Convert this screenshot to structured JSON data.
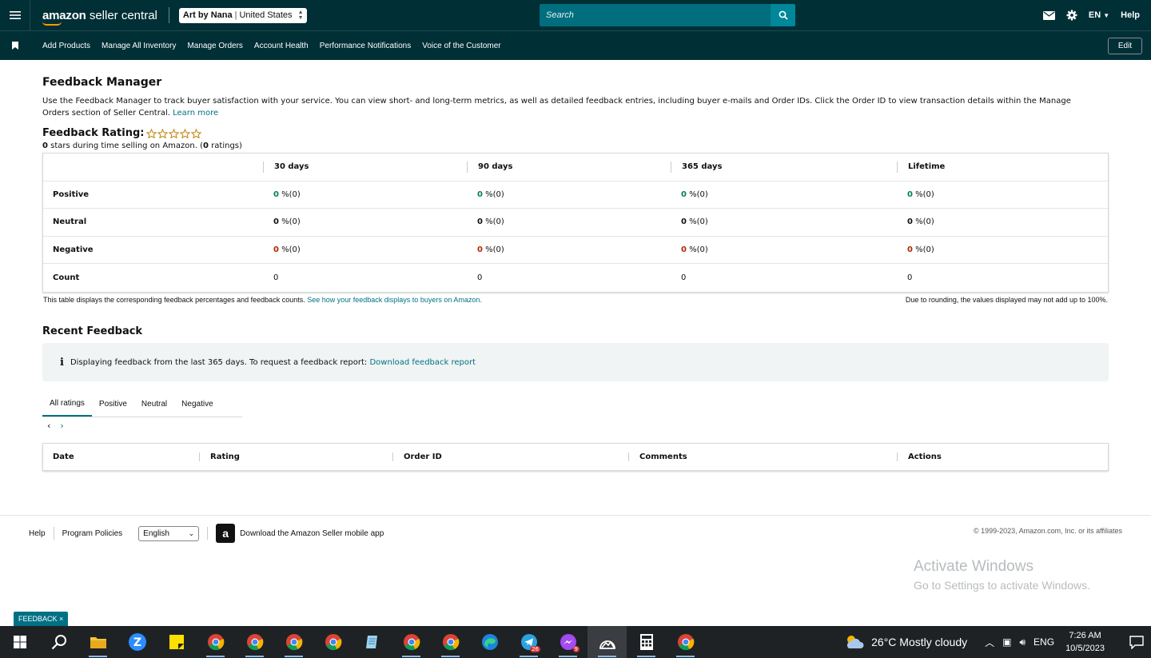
{
  "topbar": {
    "logo_main": "amazon",
    "logo_sub": "seller central",
    "store_name": "Art by Nana",
    "store_country": "United States",
    "search_placeholder": "Search",
    "lang": "EN",
    "help": "Help"
  },
  "nav": {
    "items": [
      "Add Products",
      "Manage All Inventory",
      "Manage Orders",
      "Account Health",
      "Performance Notifications",
      "Voice of the Customer"
    ],
    "edit": "Edit"
  },
  "page": {
    "title": "Feedback Manager",
    "description": "Use the Feedback Manager to track buyer satisfaction with your service. You can view short- and long-term metrics, as well as detailed feedback entries, including buyer e-mails and Order IDs. Click the Order ID to view transaction details within the Manage Orders section of Seller Central.",
    "learn_more": "Learn more",
    "rating_label": "Feedback Rating:",
    "stars_count": "0",
    "rating_sub_text": "stars during time selling on Amazon.",
    "ratings_count": "0",
    "ratings_word": "ratings"
  },
  "metrics": {
    "headers": [
      "30 days",
      "90 days",
      "365 days",
      "Lifetime"
    ],
    "rows": [
      {
        "label": "Positive",
        "cells": [
          {
            "v": "0",
            "p": "%(0)"
          },
          {
            "v": "0",
            "p": "%(0)"
          },
          {
            "v": "0",
            "p": "%(0)"
          },
          {
            "v": "0",
            "p": "%(0)"
          }
        ]
      },
      {
        "label": "Neutral",
        "cells": [
          {
            "v": "0",
            "p": "%(0)"
          },
          {
            "v": "0",
            "p": "%(0)"
          },
          {
            "v": "0",
            "p": "%(0)"
          },
          {
            "v": "0",
            "p": "%(0)"
          }
        ]
      },
      {
        "label": "Negative",
        "cells": [
          {
            "v": "0",
            "p": "%(0)"
          },
          {
            "v": "0",
            "p": "%(0)"
          },
          {
            "v": "0",
            "p": "%(0)"
          },
          {
            "v": "0",
            "p": "%(0)"
          }
        ]
      },
      {
        "label": "Count",
        "cells": [
          "0",
          "0",
          "0",
          "0"
        ]
      }
    ],
    "note_left": "This table displays the corresponding feedback percentages and feedback counts.",
    "note_left_link": "See how your feedback displays to buyers on Amazon.",
    "note_right": "Due to rounding, the values displayed may not add up to 100%."
  },
  "recent": {
    "title": "Recent Feedback",
    "info_text": "Displaying feedback from the last 365 days. To request a feedback report:",
    "info_link": "Download feedback report",
    "tabs": [
      "All ratings",
      "Positive",
      "Neutral",
      "Negative"
    ],
    "columns": [
      "Date",
      "Rating",
      "Order ID",
      "Comments",
      "Actions"
    ]
  },
  "footer": {
    "help": "Help",
    "policies": "Program Policies",
    "language": "English",
    "app_text": "Download the Amazon Seller mobile app",
    "copyright": "© 1999-2023, Amazon.com, Inc. or its affiliates"
  },
  "watermark": {
    "line1": "Activate Windows",
    "line2": "Go to Settings to activate Windows."
  },
  "feedback_tab": "FEEDBACK",
  "taskbar": {
    "weather": "26°C  Mostly cloudy",
    "lang": "ENG",
    "time": "7:26 AM",
    "date": "10/5/2023",
    "badges": {
      "telegram": "26",
      "messenger": "9"
    }
  },
  "colors": {
    "topbar": "#002f36",
    "link": "#007185",
    "positive": "#067d62",
    "negative": "#b12704"
  }
}
